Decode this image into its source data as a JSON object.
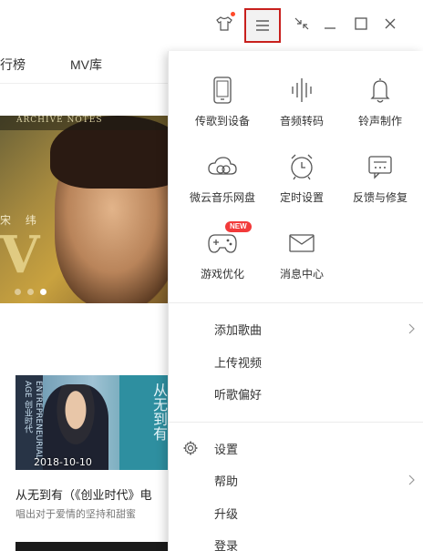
{
  "titlebar": {
    "icons": [
      "skin-icon",
      "menu-icon",
      "shrink-icon",
      "minimize-icon",
      "maximize-icon",
      "close-icon"
    ],
    "notification_dot_color": "#ff4a2a",
    "highlight_border_color": "#c8201d"
  },
  "nav": {
    "items": [
      {
        "label": "行榜"
      },
      {
        "label": "MV库"
      }
    ]
  },
  "banner": {
    "caption": "ARCHIVE NOTES",
    "artist": "宋 纬",
    "big_letter": "V",
    "dots_count": 3,
    "active_dot_index": 2
  },
  "mv_card": {
    "side_text": "ENTREPRENEURIAL AGE 创业时代",
    "right_text": "从无到有",
    "date": "2018-10-10",
    "title": "从无到有（《创业时代》电",
    "subtitle": "唱出对于爱情的坚持和甜蜜"
  },
  "menu": {
    "grid": [
      {
        "label": "传歌到设备",
        "icon": "phone-icon"
      },
      {
        "label": "音频转码",
        "icon": "soundwave-icon"
      },
      {
        "label": "铃声制作",
        "icon": "bell-icon"
      },
      {
        "label": "微云音乐网盘",
        "icon": "cloud-icon"
      },
      {
        "label": "定时设置",
        "icon": "alarm-clock-icon"
      },
      {
        "label": "反馈与修复",
        "icon": "feedback-icon"
      },
      {
        "label": "游戏优化",
        "icon": "gamepad-icon",
        "badge": "NEW"
      },
      {
        "label": "消息中心",
        "icon": "mail-icon"
      }
    ],
    "list1": [
      {
        "label": "添加歌曲",
        "has_submenu": true
      },
      {
        "label": "上传视频",
        "has_submenu": false
      },
      {
        "label": "听歌偏好",
        "has_submenu": false
      }
    ],
    "list2": [
      {
        "label": "设置",
        "icon": "gear-icon",
        "has_submenu": false
      },
      {
        "label": "帮助",
        "has_submenu": true
      },
      {
        "label": "升级",
        "has_submenu": false
      },
      {
        "label": "登录",
        "has_submenu": false
      }
    ],
    "badge_color": "#f23a3a"
  }
}
